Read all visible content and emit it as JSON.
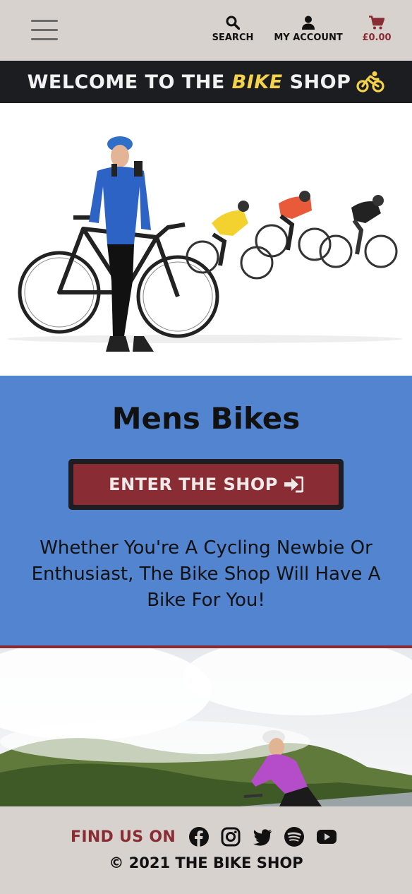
{
  "nav": {
    "menu_icon": "hamburger-menu-icon",
    "search_label": "SEARCH",
    "account_label": "MY ACCOUNT",
    "cart_total": "£0.00"
  },
  "banner": {
    "prefix": "WELCOME TO THE ",
    "accent": "BIKE",
    "suffix": " SHOP",
    "icon": "cyclist-icon",
    "accent_color": "#f4d24a"
  },
  "hero": {
    "image": "man-in-blue-cycling-kit-with-road-bike-and-group-of-cyclists"
  },
  "promo": {
    "title": "Mens Bikes",
    "button_label": "ENTER THE SHOP",
    "button_icon": "sign-in-arrow-icon",
    "tagline": "Whether You're A Cycling Newbie Or Enthusiast, The Bike Shop Will Have A Bike For You!",
    "background": "#5284cf",
    "button_color": "#8a2c33"
  },
  "scenery": {
    "image": "cyclist-in-purple-jacket-riding-mountain-road-in-clouds"
  },
  "footer": {
    "find_label": "FIND US ON",
    "social_icons": [
      "facebook-icon",
      "instagram-icon",
      "twitter-icon",
      "spotify-icon",
      "youtube-icon"
    ],
    "copyright": "© 2021 THE BIKE SHOP"
  }
}
